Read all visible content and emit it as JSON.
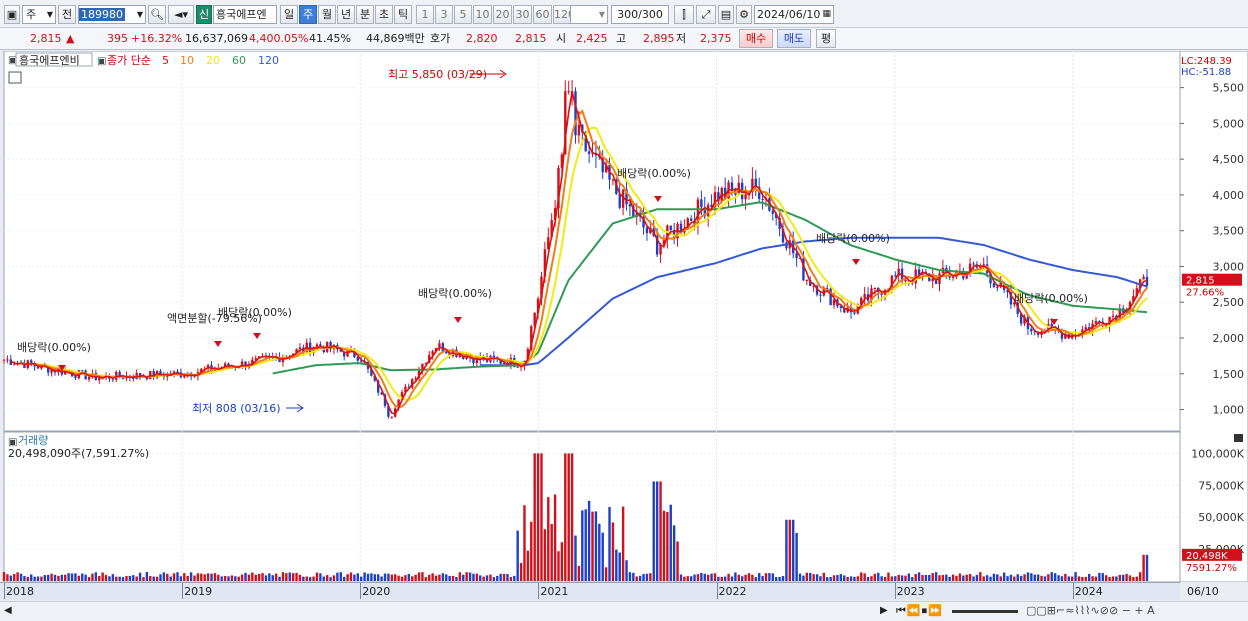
{
  "toolbar": {
    "period_type": "주",
    "prev_label": "전",
    "code": "189980",
    "stock_name": "흥국에프엔",
    "new_badge": "신",
    "tabs": [
      "일",
      "주",
      "월",
      "년",
      "분",
      "초",
      "틱"
    ],
    "active_tab": "주",
    "tick_buttons": [
      "1",
      "3",
      "5",
      "10",
      "20",
      "30",
      "60",
      "120"
    ],
    "count_current": "300",
    "count_total": "/300",
    "date": "2024/06/10"
  },
  "quote": {
    "price": "2,815",
    "arrow": "▲",
    "change": "395",
    "change_pct": "+16.32%",
    "volume": "16,637,069",
    "vol_ratio": "4,400.05%",
    "turnover": "41.45%",
    "amount": "44,869백만",
    "ask_label": "호가",
    "ask1": "2,820",
    "ask2": "2,815",
    "open_label": "시",
    "open": "2,425",
    "high_label": "고",
    "high": "2,895",
    "low_label": "저",
    "low": "2,375",
    "buy": "매수",
    "sell": "매도",
    "eval": "평"
  },
  "legend": {
    "name": "흥국에프엔비",
    "ma_title": "종가 단순",
    "periods": [
      "5",
      "10",
      "20",
      "60",
      "120"
    ]
  },
  "lc": "LC:248.39",
  "hc": "HC:-51.88",
  "annotations": {
    "max": "최고 5,850 (03/29)",
    "min": "최저 808 (03/16)",
    "div1": "배당락(0.00%)",
    "split": "액면분할(-79.56%)",
    "div2": "배당락(0.00%)",
    "div3": "배당락(0.00%)",
    "div4": "배당락(0.00%)",
    "div5": "배당락(0.00%)",
    "div6": "배당락(0.00%)"
  },
  "volume_panel": {
    "title": "거래량",
    "info": "20,498,090주(7,591.27%)",
    "last_label": "20,498K",
    "last_pct": "7591.27%"
  },
  "price_last_label": "2,815",
  "price_last_pct": "27.66%",
  "x_labels": [
    "2018",
    "2019",
    "2020",
    "2021",
    "2022",
    "2023",
    "2024",
    "06/10"
  ],
  "colors": {
    "up": "#d0101a",
    "down": "#1d40c8",
    "ma5": "#e01010",
    "ma10": "#f07d16",
    "ma20": "#f2ea10",
    "ma60": "#2e9a55",
    "ma120": "#3558d8"
  },
  "chart_data": {
    "type": "candlestick",
    "title": "흥국에프엔비",
    "x": [
      "2018-01",
      "2018-07",
      "2019-01",
      "2019-07",
      "2019-10",
      "2020-01",
      "2020-03",
      "2020-06",
      "2020-09",
      "2020-12",
      "2021-01",
      "2021-03",
      "2021-06",
      "2021-09",
      "2022-01",
      "2022-04",
      "2022-07",
      "2022-10",
      "2023-01",
      "2023-04",
      "2023-07",
      "2023-10",
      "2024-01",
      "2024-04",
      "2024-06"
    ],
    "close": [
      1700,
      1450,
      1500,
      1700,
      1900,
      1750,
      950,
      1900,
      1700,
      1650,
      2600,
      5000,
      4100,
      3300,
      4000,
      4100,
      2850,
      2350,
      2850,
      2850,
      3000,
      2150,
      2050,
      2350,
      2815
    ],
    "ma120": [
      null,
      null,
      null,
      null,
      null,
      null,
      null,
      null,
      1620,
      1620,
      1650,
      2000,
      2550,
      2850,
      3050,
      3250,
      3350,
      3400,
      3400,
      3400,
      3300,
      3100,
      2950,
      2850,
      2720
    ],
    "ma60": [
      null,
      null,
      null,
      1500,
      1620,
      1650,
      1550,
      1560,
      1600,
      1620,
      1800,
      2800,
      3600,
      3800,
      3800,
      3900,
      3650,
      3300,
      3100,
      2950,
      2900,
      2600,
      2450,
      2400,
      2360
    ],
    "ylim": [
      700,
      5900
    ],
    "y_ticks": [
      1000,
      1500,
      2000,
      2500,
      3000,
      3500,
      4000,
      4500,
      5000,
      5500
    ],
    "annotations": [
      {
        "label": "최고",
        "value": 5850,
        "date": "03/29"
      },
      {
        "label": "최저",
        "value": 808,
        "date": "03/16"
      }
    ],
    "volume_ylim": [
      0,
      105000
    ],
    "volume_ticks": [
      "25,000K",
      "50,000K",
      "75,000K",
      "100,000K"
    ],
    "volume_spikes": [
      {
        "x": "2021-01",
        "value": 100000
      },
      {
        "x": "2021-03",
        "value": 100000
      },
      {
        "x": "2021-09",
        "value": 78000
      },
      {
        "x": "2022-06",
        "value": 48000
      },
      {
        "x": "2024-06",
        "value": 20498
      }
    ]
  }
}
